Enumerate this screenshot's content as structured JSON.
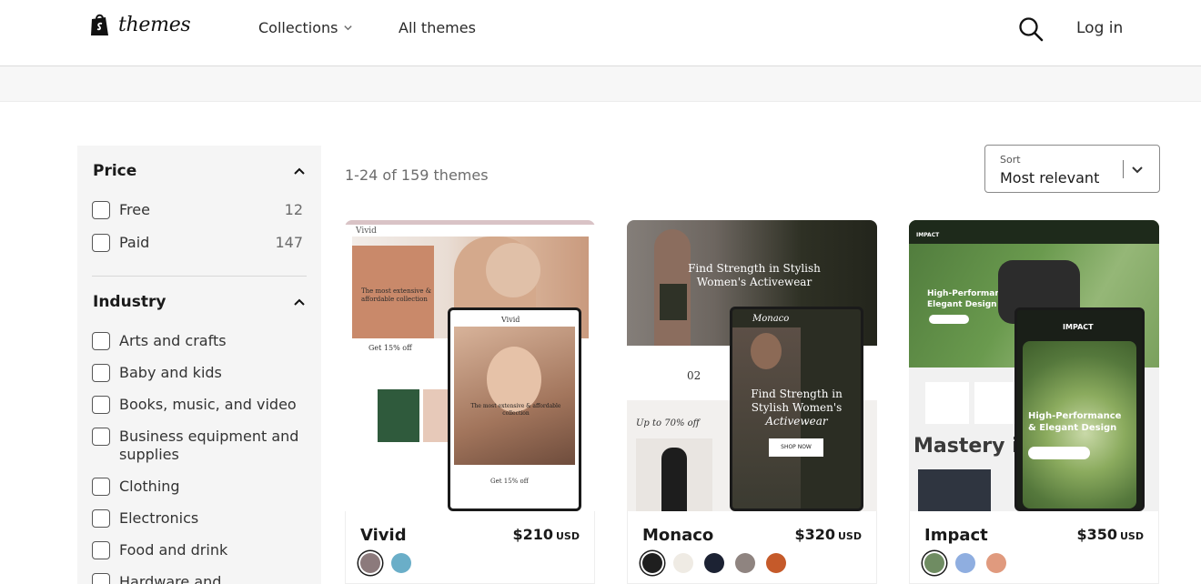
{
  "header": {
    "logo_text": "themes",
    "nav": {
      "collections": "Collections",
      "all_themes": "All themes"
    },
    "login": "Log in"
  },
  "sidebar": {
    "price": {
      "title": "Price",
      "items": [
        {
          "label": "Free",
          "count": "12"
        },
        {
          "label": "Paid",
          "count": "147"
        }
      ]
    },
    "industry": {
      "title": "Industry",
      "items": [
        {
          "label": "Arts and crafts"
        },
        {
          "label": "Baby and kids"
        },
        {
          "label": "Books, music, and video"
        },
        {
          "label": "Business equipment and supplies"
        },
        {
          "label": "Clothing"
        },
        {
          "label": "Electronics"
        },
        {
          "label": "Food and drink"
        },
        {
          "label": "Hardware and automotive"
        }
      ]
    }
  },
  "main": {
    "result_count": "1-24 of 159 themes",
    "sort": {
      "label": "Sort",
      "value": "Most relevant"
    }
  },
  "themes": [
    {
      "name": "Vivid",
      "price": "$210",
      "currency": "USD",
      "swatches": [
        "#8c7a7c",
        "#6aaec8"
      ],
      "preview": {
        "desktop_logo": "Vivid",
        "desktop_headline": "The most extensive & affordable collection",
        "desktop_promo": "Get 15% off",
        "phone_logo": "Vivid",
        "phone_headline": "The most extensive & affordable collection",
        "phone_promo": "Get 15% off"
      }
    },
    {
      "name": "Monaco",
      "price": "$320",
      "currency": "USD",
      "swatches": [
        "#1f1f1f",
        "#efebe4",
        "#1c2233",
        "#8f8480",
        "#c55a2a"
      ],
      "preview": {
        "desktop_headline_1": "Find Strength in Stylish",
        "desktop_headline_2": "Women's Activewear",
        "desktop_date": "02",
        "desktop_promo": "Up to 70% off",
        "phone_logo": "Monaco",
        "phone_headline_1": "Find Strength in",
        "phone_headline_2": "Stylish Women's",
        "phone_headline_3": "Activewear",
        "phone_cta": "SHOP NOW"
      }
    },
    {
      "name": "Impact",
      "price": "$350",
      "currency": "USD",
      "swatches": [
        "#6f8c62",
        "#8faee0",
        "#e09a7e"
      ],
      "preview": {
        "desktop_logo": "IMPACT",
        "desktop_headline_1": "High-Performance &",
        "desktop_headline_2": "Elegant Design",
        "desktop_banner": "Mastery is",
        "phone_logo": "IMPACT",
        "phone_headline_1": "High-Performance",
        "phone_headline_2": "& Elegant Design"
      }
    }
  ]
}
